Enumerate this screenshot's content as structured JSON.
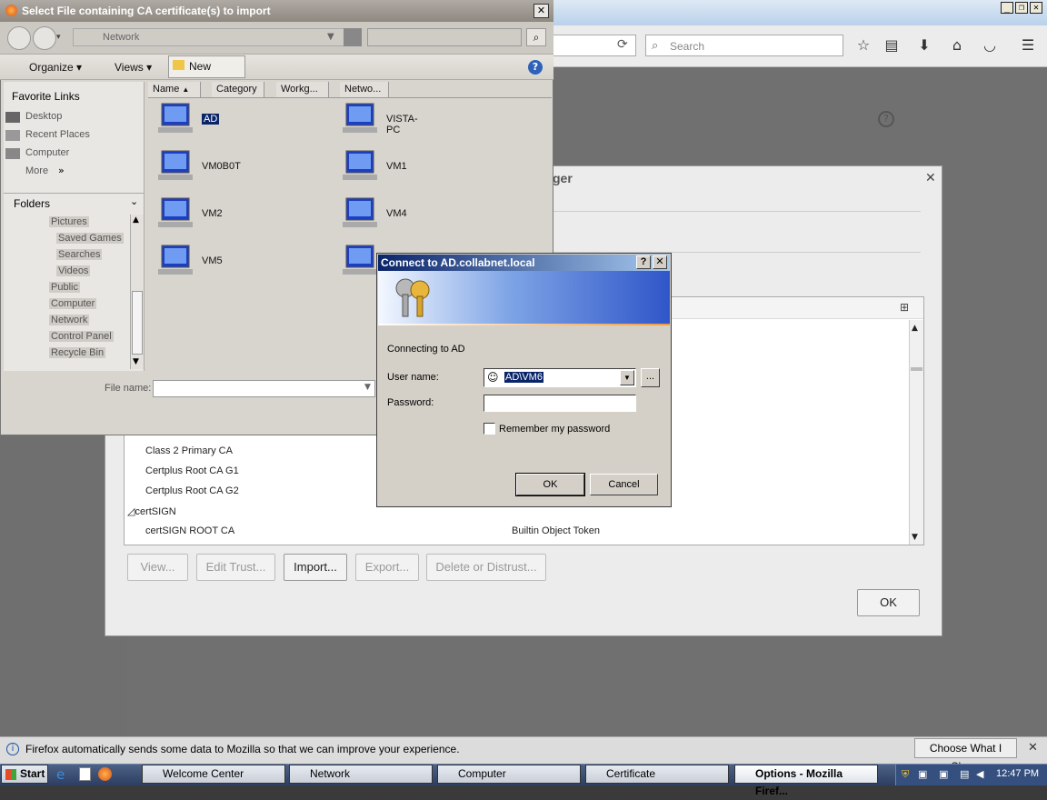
{
  "firefox": {
    "search_placeholder": "Search",
    "cert_manager_title_fragment": "ger",
    "cert_rows": [
      {
        "name": "Class 2 Primary CA",
        "token": ""
      },
      {
        "name": "Certplus Root CA G1",
        "token": ""
      },
      {
        "name": "Certplus Root CA G2",
        "token": ""
      },
      {
        "name": "certSIGN",
        "token": "",
        "group": true
      },
      {
        "name": "certSIGN ROOT CA",
        "token": "Builtin Object Token"
      }
    ],
    "buttons": {
      "view": "View...",
      "edit_trust": "Edit Trust...",
      "import": "Import...",
      "export": "Export...",
      "delete": "Delete or Distrust...",
      "ok": "OK"
    },
    "notification": {
      "text": "Firefox automatically sends some data to Mozilla so that we can improve your experience.",
      "button": "Choose What I Share"
    }
  },
  "file_dialog": {
    "title": "Select File containing CA certificate(s) to import",
    "address": "Network",
    "toolbar": {
      "organize": "Organize",
      "views": "Views",
      "new_folder": "New Folder"
    },
    "favorite_links_header": "Favorite Links",
    "favorite_links": [
      "Desktop",
      "Recent Places",
      "Computer",
      "More"
    ],
    "folders_header": "Folders",
    "folders": [
      "Pictures",
      "Saved Games",
      "Searches",
      "Videos",
      "Public",
      "Computer",
      "Network",
      "Control Panel",
      "Recycle Bin"
    ],
    "columns": [
      "Name",
      "Category",
      "Workg...",
      "Netwo..."
    ],
    "items": [
      "AD",
      "VISTA-PC",
      "VM0B0T",
      "VM1",
      "VM2",
      "VM4",
      "VM5"
    ],
    "file_name_label": "File name:"
  },
  "connect_dialog": {
    "title": "Connect to AD.collabnet.local",
    "connecting_text": "Connecting to AD",
    "username_label": "User name:",
    "username_value": "AD\\VM6",
    "password_label": "Password:",
    "remember_label": "Remember my password",
    "ok": "OK",
    "cancel": "Cancel"
  },
  "taskbar": {
    "start": "Start",
    "tasks": [
      "Welcome Center",
      "Network",
      "Computer",
      "Certificate",
      "Options - Mozilla Firef..."
    ],
    "clock": "12:47 PM"
  }
}
